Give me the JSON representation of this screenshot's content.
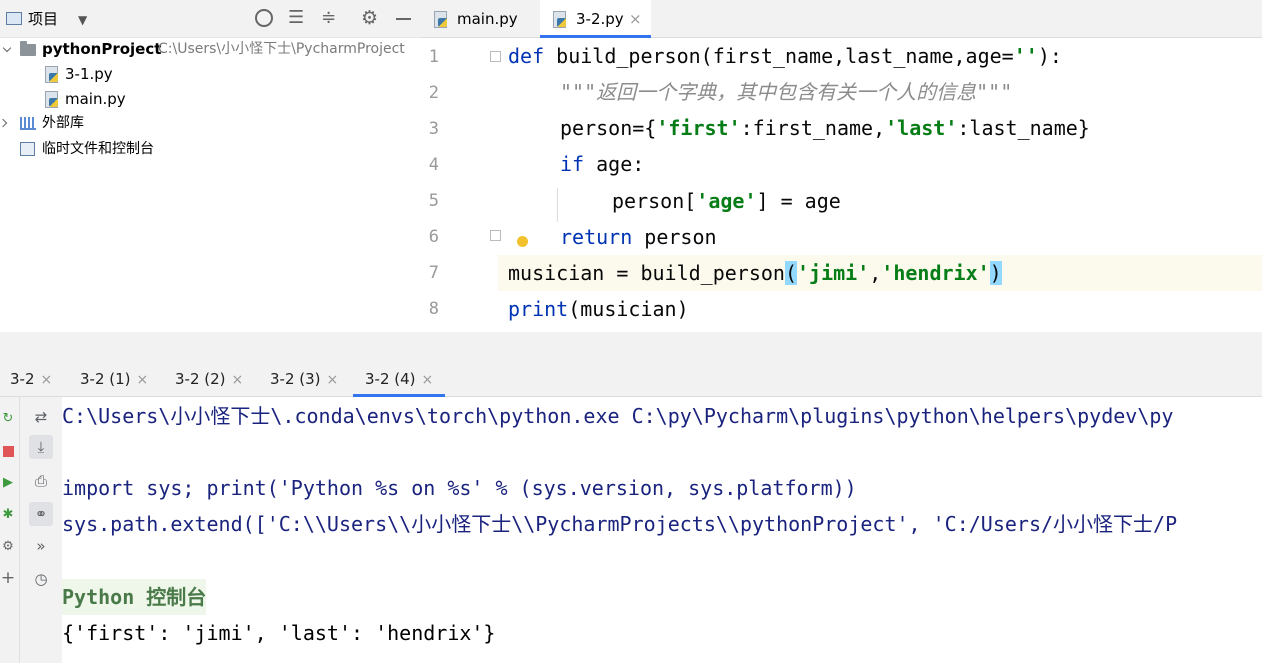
{
  "project_panel": {
    "title": "项目",
    "tree": [
      {
        "label": "pythonProject",
        "path": "C:\\Users\\小小怪下士\\PycharmProject"
      },
      {
        "label": "3-1.py"
      },
      {
        "label": "main.py"
      },
      {
        "label": "外部库"
      },
      {
        "label": "临时文件和控制台"
      }
    ]
  },
  "editor": {
    "tabs": [
      {
        "label": "main.py"
      },
      {
        "label": "3-2.py"
      }
    ],
    "close_glyph": "×",
    "line_numbers": [
      "1",
      "2",
      "3",
      "4",
      "5",
      "6",
      "7",
      "8"
    ],
    "code": {
      "l1_kw": "def",
      "l1_rest": " build_person(first_name,last_name,age=",
      "l1_str": "''",
      "l1_end": "):",
      "l2_doc": "\"\"\"返回一个字典，其中包含有关一个人的信息\"\"\"",
      "l3_a": "person={",
      "l3_s1": "'first'",
      "l3_b": ":first_name,",
      "l3_s2": "'last'",
      "l3_c": ":last_name}",
      "l4_kw": "if",
      "l4_rest": " age:",
      "l5_a": "person[",
      "l5_s": "'age'",
      "l5_b": "] = age",
      "l6_kw": "return",
      "l6_rest": " person",
      "l7_a": "musician = build_person",
      "l7_p1": "(",
      "l7_s1": "'jimi'",
      "l7_comma": ",",
      "l7_s2": "'hendrix'",
      "l7_p2": ")",
      "l8_kw": "print",
      "l8_rest": "(musician)"
    }
  },
  "console": {
    "tabs": [
      {
        "label": "3-2"
      },
      {
        "label": "3-2 (1)"
      },
      {
        "label": "3-2 (2)"
      },
      {
        "label": "3-2 (3)"
      },
      {
        "label": "3-2 (4)"
      }
    ],
    "close_glyph": "×",
    "lines": [
      "C:\\Users\\小小怪下士\\.conda\\envs\\torch\\python.exe C:\\py\\Pycharm\\plugins\\python\\helpers\\pydev\\py",
      "",
      "import sys; print('Python %s on %s' % (sys.version, sys.platform))",
      "sys.path.extend(['C:\\\\Users\\\\小小怪下士\\\\PycharmProjects\\\\pythonProject', 'C:/Users/小小怪下士/P",
      "",
      "Python 控制台",
      "{'first': 'jimi', 'last': 'hendrix'}"
    ]
  },
  "colors": {
    "accent": "#3574f0",
    "keyword": "#0033b3",
    "string": "#067d17",
    "doc": "#8c8c8c",
    "current_line": "#fcfaed",
    "console_text": "#1a237e"
  }
}
